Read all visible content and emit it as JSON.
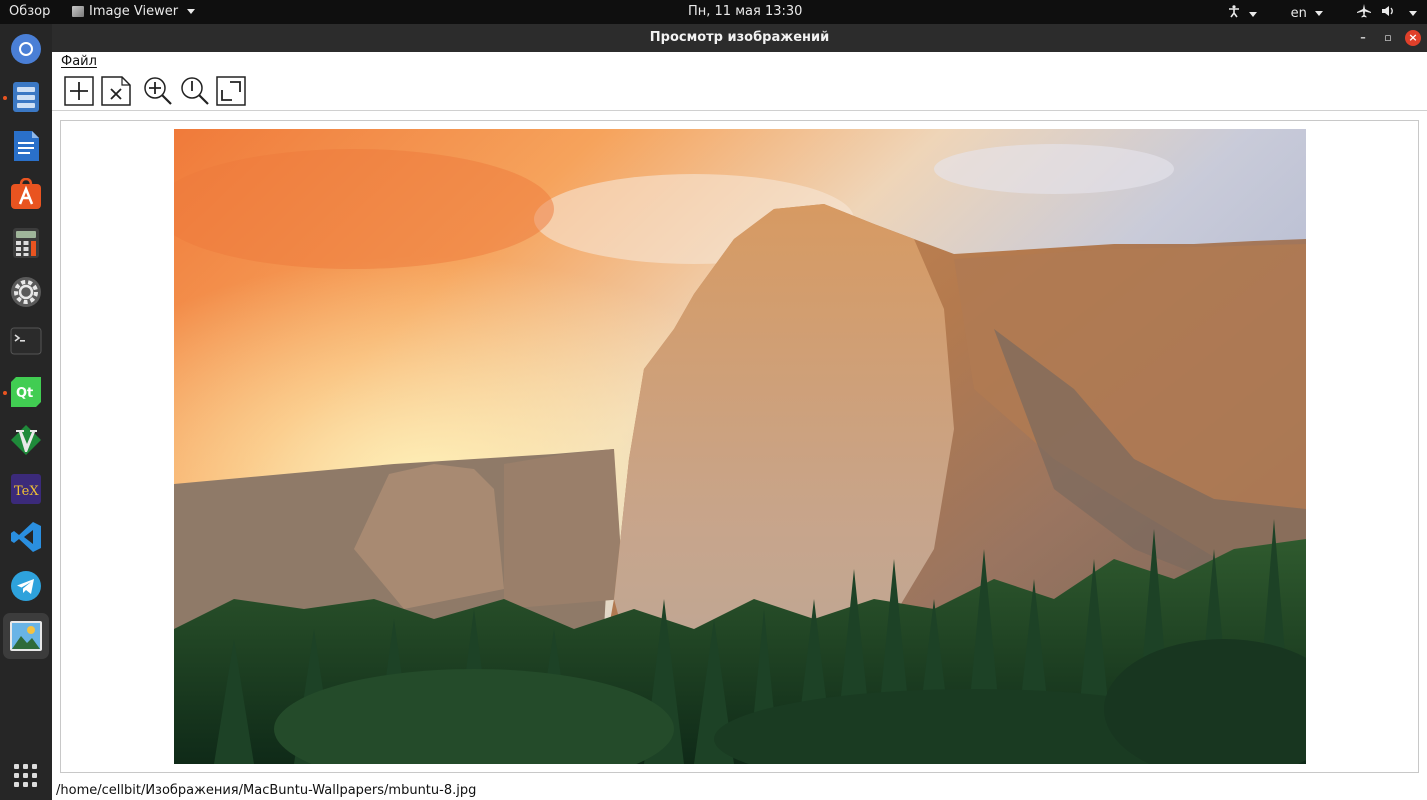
{
  "topbar": {
    "activities": "Обзор",
    "app_menu": "Image Viewer",
    "clock": "Пн, 11 мая  13:30",
    "language": "en"
  },
  "dock": {
    "items": [
      "chromium-icon",
      "files-icon",
      "writer-icon",
      "software-center-icon",
      "calculator-icon",
      "settings-icon",
      "terminal-icon",
      "qt-creator-icon",
      "vim-icon",
      "texmaker-icon",
      "vscode-icon",
      "telegram-icon",
      "image-viewer-icon"
    ]
  },
  "window": {
    "title": "Просмотр изображений"
  },
  "menubar": {
    "file": "Файл"
  },
  "toolbar": {
    "tools": [
      "open-icon",
      "close-icon",
      "zoom-in-icon",
      "zoom-reset-icon",
      "fit-window-icon"
    ]
  },
  "status": {
    "path": "/home/cellbit/Изображения/MacBuntu-Wallpapers/mbuntu-8.jpg"
  },
  "colors": {
    "accent": "#e95420",
    "close_button": "#e0402a"
  }
}
